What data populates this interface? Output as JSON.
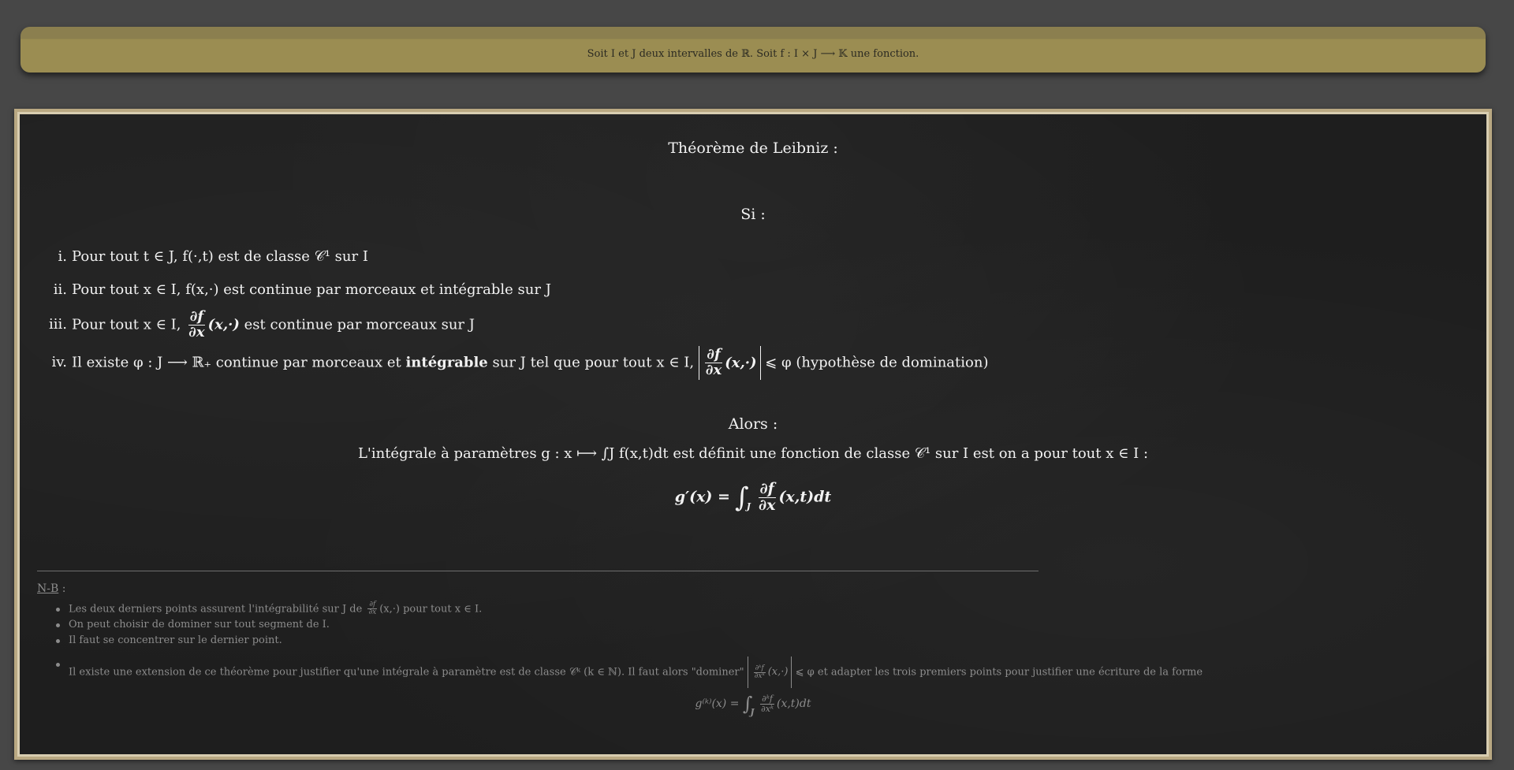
{
  "context": {
    "text": "Soit I et J deux intervalles de ℝ. Soit f : I × J ⟶ 𝕂 une fonction."
  },
  "board": {
    "title": "Théorème de Leibniz :",
    "si": "Si :",
    "hypotheses": [
      {
        "num": "i.",
        "text": "Pour tout t ∈ J, f(·,t) est de classe 𝒞¹ sur I"
      },
      {
        "num": "ii.",
        "text": "Pour tout x ∈ I, f(x,·) est continue par morceaux et intégrable sur J"
      },
      {
        "num": "iii.",
        "pre": "Pour tout x ∈ I,",
        "frac_num": "∂f",
        "frac_den": "∂x",
        "post_frac": "(x,·)",
        "post": "est continue par morceaux sur J"
      },
      {
        "num": "iv.",
        "pre": "Il existe φ : J ⟶ ℝ₊ continue par morceaux et",
        "bold": "intégrable",
        "mid": "sur J tel que pour tout x ∈ I,",
        "frac_num": "∂f",
        "frac_den": "∂x",
        "post_frac": "(x,·)",
        "post": "⩽ φ (hypothèse de domination)"
      }
    ],
    "alors": "Alors :",
    "conclusion": "L'intégrale à paramètres g : x ⟼ ∫J f(x,t)dt est définit une fonction de classe 𝒞¹ sur I est on a pour tout x ∈ I :",
    "formula": {
      "lhs": "g′(x) =",
      "int": "∫",
      "sub": "J",
      "frac_num": "∂f",
      "frac_den": "∂x",
      "rhs": "(x,t)dt"
    }
  },
  "notes": {
    "label": "N-B",
    "label_suffix": " :",
    "items": [
      {
        "pre": "Les deux derniers points assurent l'intégrabilité sur J de",
        "frac_num": "∂f",
        "frac_den": "∂x",
        "post": "(x,·) pour tout x ∈ I."
      },
      {
        "text": "On peut choisir de dominer sur tout segment de I."
      },
      {
        "text": "Il faut se concentrer sur le dernier point."
      },
      {
        "pre": "Il existe une extension de ce théorème pour justifier qu'une intégrale à paramètre est de classe 𝒞ᵏ (k ∈ ℕ). Il faut alors \"dominer\"",
        "frac_num": "∂ᵏf",
        "frac_den": "∂xᵏ",
        "post_frac": "(x,·)",
        "post": "⩽ φ et adapter les trois premiers points pour justifier une écriture de la forme"
      }
    ],
    "formula": {
      "lhs": "g⁽ᵏ⁾(x) =",
      "int": "∫",
      "sub": "J",
      "frac_num": "∂ᵏf",
      "frac_den": "∂xᵏ",
      "rhs": "(x,t)dt"
    }
  }
}
